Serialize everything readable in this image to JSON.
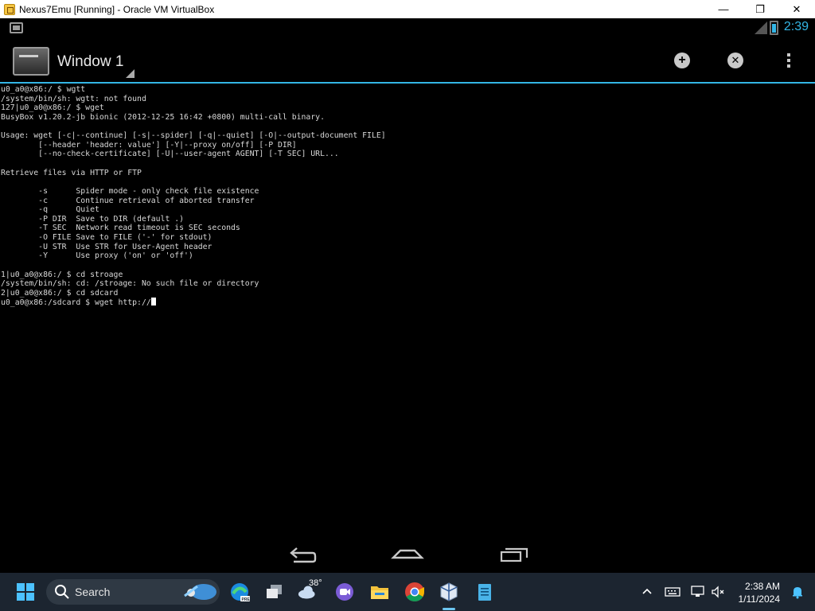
{
  "window": {
    "title": "Nexus7Emu [Running] - Oracle VM VirtualBox",
    "minimize_glyph": "—",
    "restore_glyph": "❐",
    "close_glyph": "✕"
  },
  "statusbar": {
    "time": "2:39",
    "accent": "#34b5e5"
  },
  "actionbar": {
    "window_title": "Window 1",
    "new_window_glyph": "+",
    "close_window_glyph": "✕"
  },
  "terminal": {
    "lines": [
      "u0_a0@x86:/ $ wgtt",
      "/system/bin/sh: wgtt: not found",
      "127|u0_a0@x86:/ $ wget",
      "BusyBox v1.20.2-jb bionic (2012-12-25 16:42 +0800) multi-call binary.",
      "",
      "Usage: wget [-c|--continue] [-s|--spider] [-q|--quiet] [-O|--output-document FILE]",
      "        [--header 'header: value'] [-Y|--proxy on/off] [-P DIR]",
      "        [--no-check-certificate] [-U|--user-agent AGENT] [-T SEC] URL...",
      "",
      "Retrieve files via HTTP or FTP",
      "",
      "        -s      Spider mode - only check file existence",
      "        -c      Continue retrieval of aborted transfer",
      "        -q      Quiet",
      "        -P DIR  Save to DIR (default .)",
      "        -T SEC  Network read timeout is SEC seconds",
      "        -O FILE Save to FILE ('-' for stdout)",
      "        -U STR  Use STR for User-Agent header",
      "        -Y      Use proxy ('on' or 'off')",
      "",
      "1|u0_a0@x86:/ $ cd stroage",
      "/system/bin/sh: cd: /stroage: No such file or directory",
      "2|u0_a0@x86:/ $ cd sdcard"
    ],
    "current_prompt": "u0_a0@x86:/sdcard $ wget http://"
  },
  "navbar": {
    "icons": [
      "back-icon",
      "home-icon",
      "recent-apps-icon"
    ]
  },
  "taskbar": {
    "search_label": "Search",
    "weather_temp": "38°",
    "time": "2:38 AM",
    "date": "1/11/2024",
    "pinned_icons": [
      "edge-icon",
      "task-view-icon",
      "weather-icon",
      "teams-icon",
      "file-explorer-icon",
      "chrome-icon",
      "virtualbox-icon",
      "notepad-icon"
    ],
    "tray_icons": [
      "chevron-up-icon",
      "keyboard-icon",
      "network-icon",
      "volume-muted-icon",
      "notification-bell-icon"
    ]
  }
}
